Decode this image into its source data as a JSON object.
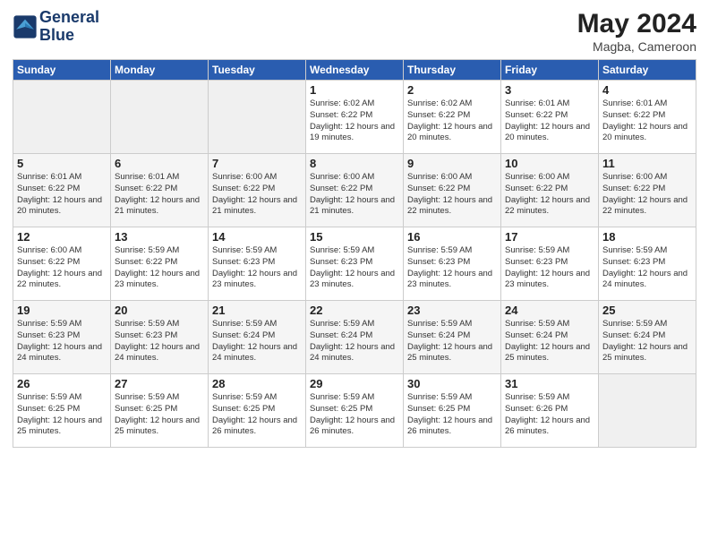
{
  "header": {
    "logo_line1": "General",
    "logo_line2": "Blue",
    "month": "May 2024",
    "location": "Magba, Cameroon"
  },
  "days_of_week": [
    "Sunday",
    "Monday",
    "Tuesday",
    "Wednesday",
    "Thursday",
    "Friday",
    "Saturday"
  ],
  "weeks": [
    [
      {
        "day": "",
        "sunrise": "",
        "sunset": "",
        "daylight": "",
        "empty": true
      },
      {
        "day": "",
        "sunrise": "",
        "sunset": "",
        "daylight": "",
        "empty": true
      },
      {
        "day": "",
        "sunrise": "",
        "sunset": "",
        "daylight": "",
        "empty": true
      },
      {
        "day": "1",
        "sunrise": "Sunrise: 6:02 AM",
        "sunset": "Sunset: 6:22 PM",
        "daylight": "Daylight: 12 hours and 19 minutes.",
        "empty": false
      },
      {
        "day": "2",
        "sunrise": "Sunrise: 6:02 AM",
        "sunset": "Sunset: 6:22 PM",
        "daylight": "Daylight: 12 hours and 20 minutes.",
        "empty": false
      },
      {
        "day": "3",
        "sunrise": "Sunrise: 6:01 AM",
        "sunset": "Sunset: 6:22 PM",
        "daylight": "Daylight: 12 hours and 20 minutes.",
        "empty": false
      },
      {
        "day": "4",
        "sunrise": "Sunrise: 6:01 AM",
        "sunset": "Sunset: 6:22 PM",
        "daylight": "Daylight: 12 hours and 20 minutes.",
        "empty": false
      }
    ],
    [
      {
        "day": "5",
        "sunrise": "Sunrise: 6:01 AM",
        "sunset": "Sunset: 6:22 PM",
        "daylight": "Daylight: 12 hours and 20 minutes.",
        "empty": false
      },
      {
        "day": "6",
        "sunrise": "Sunrise: 6:01 AM",
        "sunset": "Sunset: 6:22 PM",
        "daylight": "Daylight: 12 hours and 21 minutes.",
        "empty": false
      },
      {
        "day": "7",
        "sunrise": "Sunrise: 6:00 AM",
        "sunset": "Sunset: 6:22 PM",
        "daylight": "Daylight: 12 hours and 21 minutes.",
        "empty": false
      },
      {
        "day": "8",
        "sunrise": "Sunrise: 6:00 AM",
        "sunset": "Sunset: 6:22 PM",
        "daylight": "Daylight: 12 hours and 21 minutes.",
        "empty": false
      },
      {
        "day": "9",
        "sunrise": "Sunrise: 6:00 AM",
        "sunset": "Sunset: 6:22 PM",
        "daylight": "Daylight: 12 hours and 22 minutes.",
        "empty": false
      },
      {
        "day": "10",
        "sunrise": "Sunrise: 6:00 AM",
        "sunset": "Sunset: 6:22 PM",
        "daylight": "Daylight: 12 hours and 22 minutes.",
        "empty": false
      },
      {
        "day": "11",
        "sunrise": "Sunrise: 6:00 AM",
        "sunset": "Sunset: 6:22 PM",
        "daylight": "Daylight: 12 hours and 22 minutes.",
        "empty": false
      }
    ],
    [
      {
        "day": "12",
        "sunrise": "Sunrise: 6:00 AM",
        "sunset": "Sunset: 6:22 PM",
        "daylight": "Daylight: 12 hours and 22 minutes.",
        "empty": false
      },
      {
        "day": "13",
        "sunrise": "Sunrise: 5:59 AM",
        "sunset": "Sunset: 6:22 PM",
        "daylight": "Daylight: 12 hours and 23 minutes.",
        "empty": false
      },
      {
        "day": "14",
        "sunrise": "Sunrise: 5:59 AM",
        "sunset": "Sunset: 6:23 PM",
        "daylight": "Daylight: 12 hours and 23 minutes.",
        "empty": false
      },
      {
        "day": "15",
        "sunrise": "Sunrise: 5:59 AM",
        "sunset": "Sunset: 6:23 PM",
        "daylight": "Daylight: 12 hours and 23 minutes.",
        "empty": false
      },
      {
        "day": "16",
        "sunrise": "Sunrise: 5:59 AM",
        "sunset": "Sunset: 6:23 PM",
        "daylight": "Daylight: 12 hours and 23 minutes.",
        "empty": false
      },
      {
        "day": "17",
        "sunrise": "Sunrise: 5:59 AM",
        "sunset": "Sunset: 6:23 PM",
        "daylight": "Daylight: 12 hours and 23 minutes.",
        "empty": false
      },
      {
        "day": "18",
        "sunrise": "Sunrise: 5:59 AM",
        "sunset": "Sunset: 6:23 PM",
        "daylight": "Daylight: 12 hours and 24 minutes.",
        "empty": false
      }
    ],
    [
      {
        "day": "19",
        "sunrise": "Sunrise: 5:59 AM",
        "sunset": "Sunset: 6:23 PM",
        "daylight": "Daylight: 12 hours and 24 minutes.",
        "empty": false
      },
      {
        "day": "20",
        "sunrise": "Sunrise: 5:59 AM",
        "sunset": "Sunset: 6:23 PM",
        "daylight": "Daylight: 12 hours and 24 minutes.",
        "empty": false
      },
      {
        "day": "21",
        "sunrise": "Sunrise: 5:59 AM",
        "sunset": "Sunset: 6:24 PM",
        "daylight": "Daylight: 12 hours and 24 minutes.",
        "empty": false
      },
      {
        "day": "22",
        "sunrise": "Sunrise: 5:59 AM",
        "sunset": "Sunset: 6:24 PM",
        "daylight": "Daylight: 12 hours and 24 minutes.",
        "empty": false
      },
      {
        "day": "23",
        "sunrise": "Sunrise: 5:59 AM",
        "sunset": "Sunset: 6:24 PM",
        "daylight": "Daylight: 12 hours and 25 minutes.",
        "empty": false
      },
      {
        "day": "24",
        "sunrise": "Sunrise: 5:59 AM",
        "sunset": "Sunset: 6:24 PM",
        "daylight": "Daylight: 12 hours and 25 minutes.",
        "empty": false
      },
      {
        "day": "25",
        "sunrise": "Sunrise: 5:59 AM",
        "sunset": "Sunset: 6:24 PM",
        "daylight": "Daylight: 12 hours and 25 minutes.",
        "empty": false
      }
    ],
    [
      {
        "day": "26",
        "sunrise": "Sunrise: 5:59 AM",
        "sunset": "Sunset: 6:25 PM",
        "daylight": "Daylight: 12 hours and 25 minutes.",
        "empty": false
      },
      {
        "day": "27",
        "sunrise": "Sunrise: 5:59 AM",
        "sunset": "Sunset: 6:25 PM",
        "daylight": "Daylight: 12 hours and 25 minutes.",
        "empty": false
      },
      {
        "day": "28",
        "sunrise": "Sunrise: 5:59 AM",
        "sunset": "Sunset: 6:25 PM",
        "daylight": "Daylight: 12 hours and 26 minutes.",
        "empty": false
      },
      {
        "day": "29",
        "sunrise": "Sunrise: 5:59 AM",
        "sunset": "Sunset: 6:25 PM",
        "daylight": "Daylight: 12 hours and 26 minutes.",
        "empty": false
      },
      {
        "day": "30",
        "sunrise": "Sunrise: 5:59 AM",
        "sunset": "Sunset: 6:25 PM",
        "daylight": "Daylight: 12 hours and 26 minutes.",
        "empty": false
      },
      {
        "day": "31",
        "sunrise": "Sunrise: 5:59 AM",
        "sunset": "Sunset: 6:26 PM",
        "daylight": "Daylight: 12 hours and 26 minutes.",
        "empty": false
      },
      {
        "day": "",
        "sunrise": "",
        "sunset": "",
        "daylight": "",
        "empty": true
      }
    ]
  ]
}
